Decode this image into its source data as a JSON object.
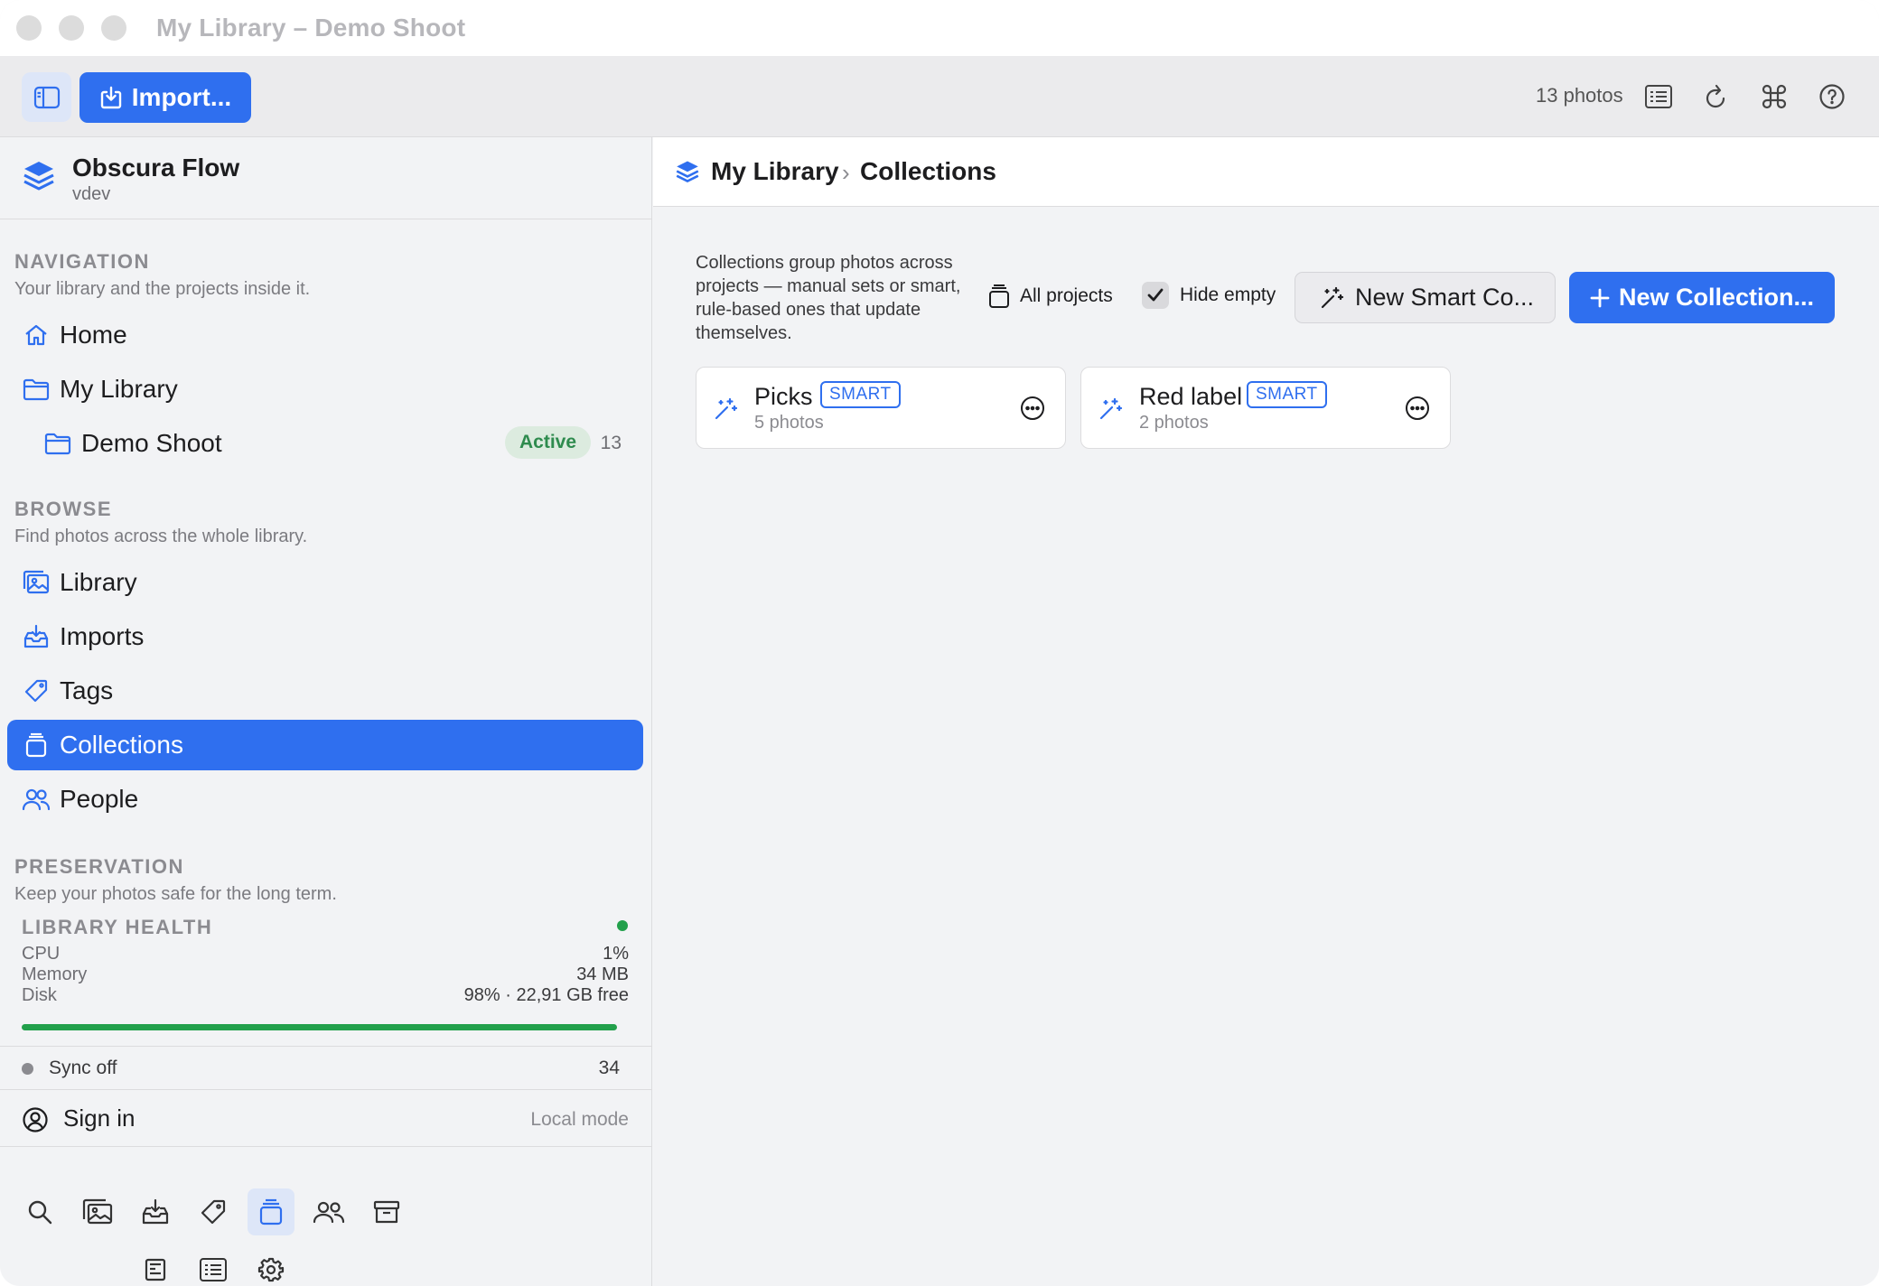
{
  "window": {
    "title": "My Library – Demo Shoot"
  },
  "toolbar": {
    "import_label": "Import...",
    "photo_count": "13 photos"
  },
  "app": {
    "name": "Obscura Flow",
    "subtitle": "vdev"
  },
  "navigation": {
    "title": "NAVIGATION",
    "subtitle": "Your library and the projects inside it.",
    "items": [
      {
        "label": "Home",
        "icon": "home-icon"
      },
      {
        "label": "My Library",
        "icon": "folder-icon"
      },
      {
        "label": "Demo Shoot",
        "icon": "folder-icon",
        "badge": "Active",
        "count": "13"
      }
    ]
  },
  "browse": {
    "title": "BROWSE",
    "subtitle": "Find photos across the whole library.",
    "items": [
      {
        "label": "Library",
        "icon": "photos-icon"
      },
      {
        "label": "Imports",
        "icon": "import-tray-icon"
      },
      {
        "label": "Tags",
        "icon": "tag-icon"
      },
      {
        "label": "Collections",
        "icon": "collections-icon",
        "active": true
      },
      {
        "label": "People",
        "icon": "people-icon"
      }
    ]
  },
  "preservation": {
    "title": "PRESERVATION",
    "subtitle": "Keep your photos safe for the long term."
  },
  "health": {
    "title": "LIBRARY HEALTH",
    "status_color": "#22a04b",
    "rows": [
      {
        "label": "CPU",
        "value": "1%"
      },
      {
        "label": "Memory",
        "value": "34 MB"
      },
      {
        "label": "Disk",
        "value": "98% · 22,91 GB free"
      }
    ],
    "disk_fraction": 0.98
  },
  "sync": {
    "label": "Sync off",
    "count": "34"
  },
  "account": {
    "signin_label": "Sign in",
    "mode": "Local mode"
  },
  "breadcrumb": {
    "root": "My Library",
    "separator": "›",
    "current": "Collections"
  },
  "collections_page": {
    "description": "Collections group photos across projects — manual sets or smart, rule-based ones that update themselves.",
    "all_projects_label": "All projects",
    "hide_empty_label": "Hide empty",
    "hide_empty_checked": true,
    "new_smart_label": "New Smart Co...",
    "new_collection_label": "New Collection...",
    "cards": [
      {
        "name": "Picks",
        "badge": "SMART",
        "count": "5 photos"
      },
      {
        "name": "Red label",
        "badge": "SMART",
        "count": "2 photos"
      }
    ]
  },
  "colors": {
    "accent": "#2f6fef",
    "success": "#22a04b"
  }
}
